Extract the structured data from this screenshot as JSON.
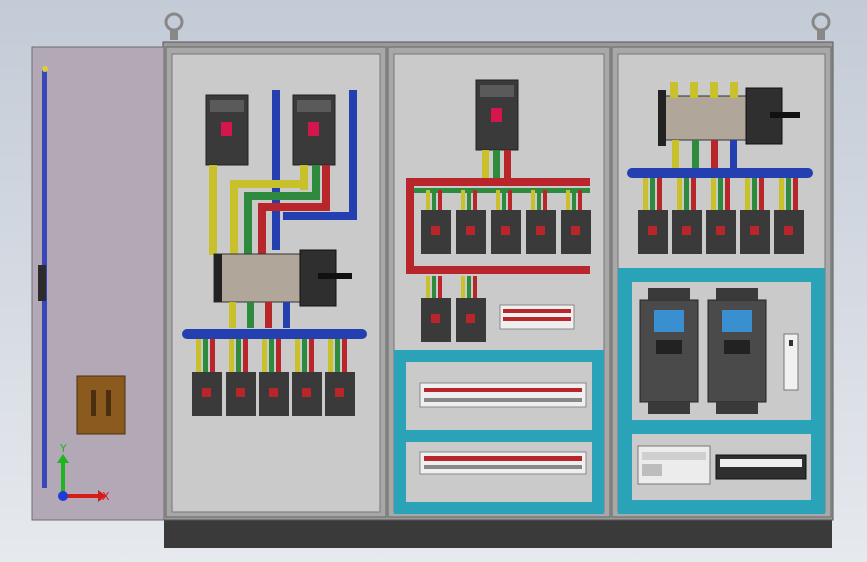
{
  "viewport": {
    "background_top": "#c3cbd6",
    "background_bottom": "#e6e9ee"
  },
  "cabinet": {
    "frame_color": "#8c8c8c",
    "panel_color": "#c9c9c9",
    "plinth_color": "#3a3a3a",
    "door_color": "#b3a9b6",
    "sections": [
      "left",
      "middle",
      "right"
    ]
  },
  "busbar_colors": {
    "phase_yellow": "#c9c12b",
    "phase_green": "#2e8a3c",
    "phase_red": "#b8262b",
    "neutral_blue": "#243fb0",
    "ground_cyan": "#2aa3b9"
  },
  "components": {
    "left_section": {
      "main_breakers": 2,
      "transfer_switch": 1,
      "feeder_breakers": 5
    },
    "middle_section": {
      "main_breakers": 1,
      "branch_breakers": 5,
      "small_breakers": 2,
      "terminal_strips": 3
    },
    "right_section": {
      "transfer_switch": 1,
      "branch_breakers": 5,
      "soft_starters": 2,
      "plc_modules": 1,
      "terminal_block": 1
    }
  },
  "triad": {
    "x_label": "X",
    "y_label": "Y",
    "x_color": "#d61b1b",
    "y_color": "#22b322",
    "z_color": "#1f3bd6"
  }
}
